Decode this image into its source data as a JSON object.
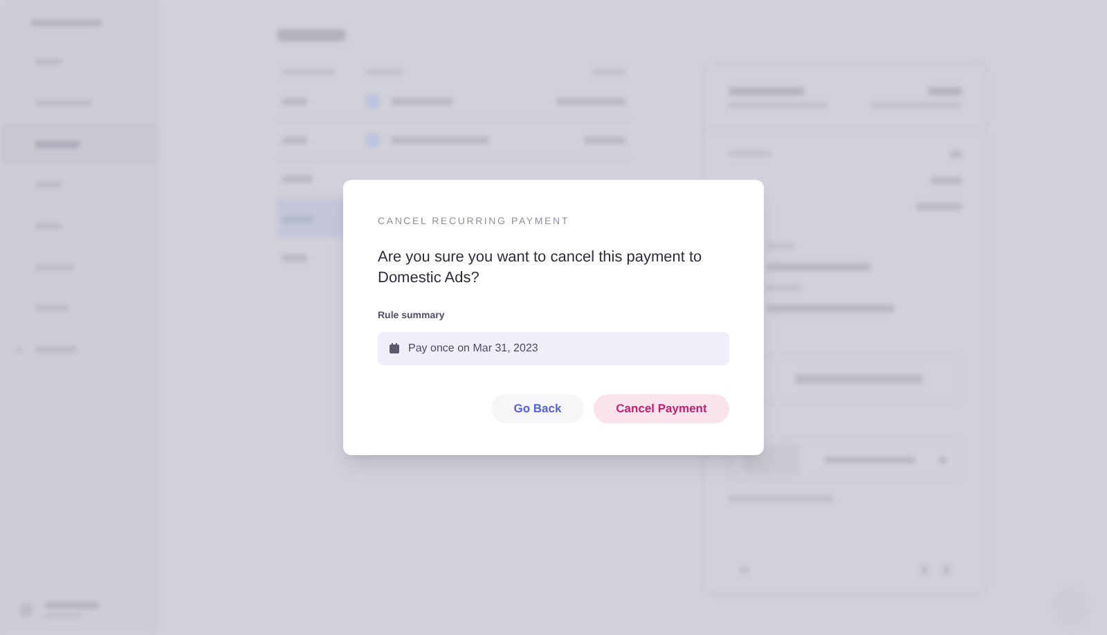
{
  "dialog": {
    "eyebrow": "CANCEL RECURRING PAYMENT",
    "question": "Are you sure you want to cancel this payment to Domestic Ads?",
    "summary_label": "Rule summary",
    "summary": "Pay once on Mar 31, 2023",
    "buttons": [
      {
        "label": "Go Back",
        "kind": "secondary"
      },
      {
        "label": "Cancel Payment",
        "kind": "danger"
      }
    ]
  }
}
